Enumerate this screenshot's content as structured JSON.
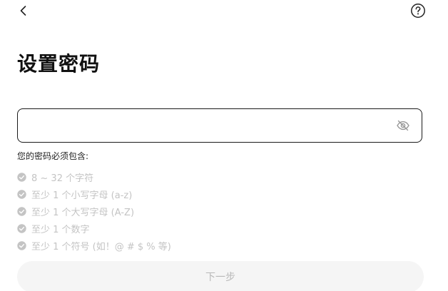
{
  "header": {
    "back_icon": "chevron-left-icon",
    "help_icon": "question-circle-icon"
  },
  "page": {
    "title": "设置密码"
  },
  "password": {
    "value": "",
    "placeholder": "",
    "visibility_icon": "eye-off-icon"
  },
  "rules": {
    "title": "您的密码必须包含:",
    "items": [
      {
        "label": "8 ~ 32 个字符"
      },
      {
        "label": "至少 1 个小写字母 (a-z)"
      },
      {
        "label": "至少 1 个大写字母 (A-Z)"
      },
      {
        "label": "至少 1 个数字"
      },
      {
        "label": "至少 1 个符号 (如！@ # $ % 等)"
      }
    ],
    "check_icon": "check-circle-icon",
    "inactive_color": "#c4c4c4"
  },
  "actions": {
    "next_label": "下一步"
  }
}
